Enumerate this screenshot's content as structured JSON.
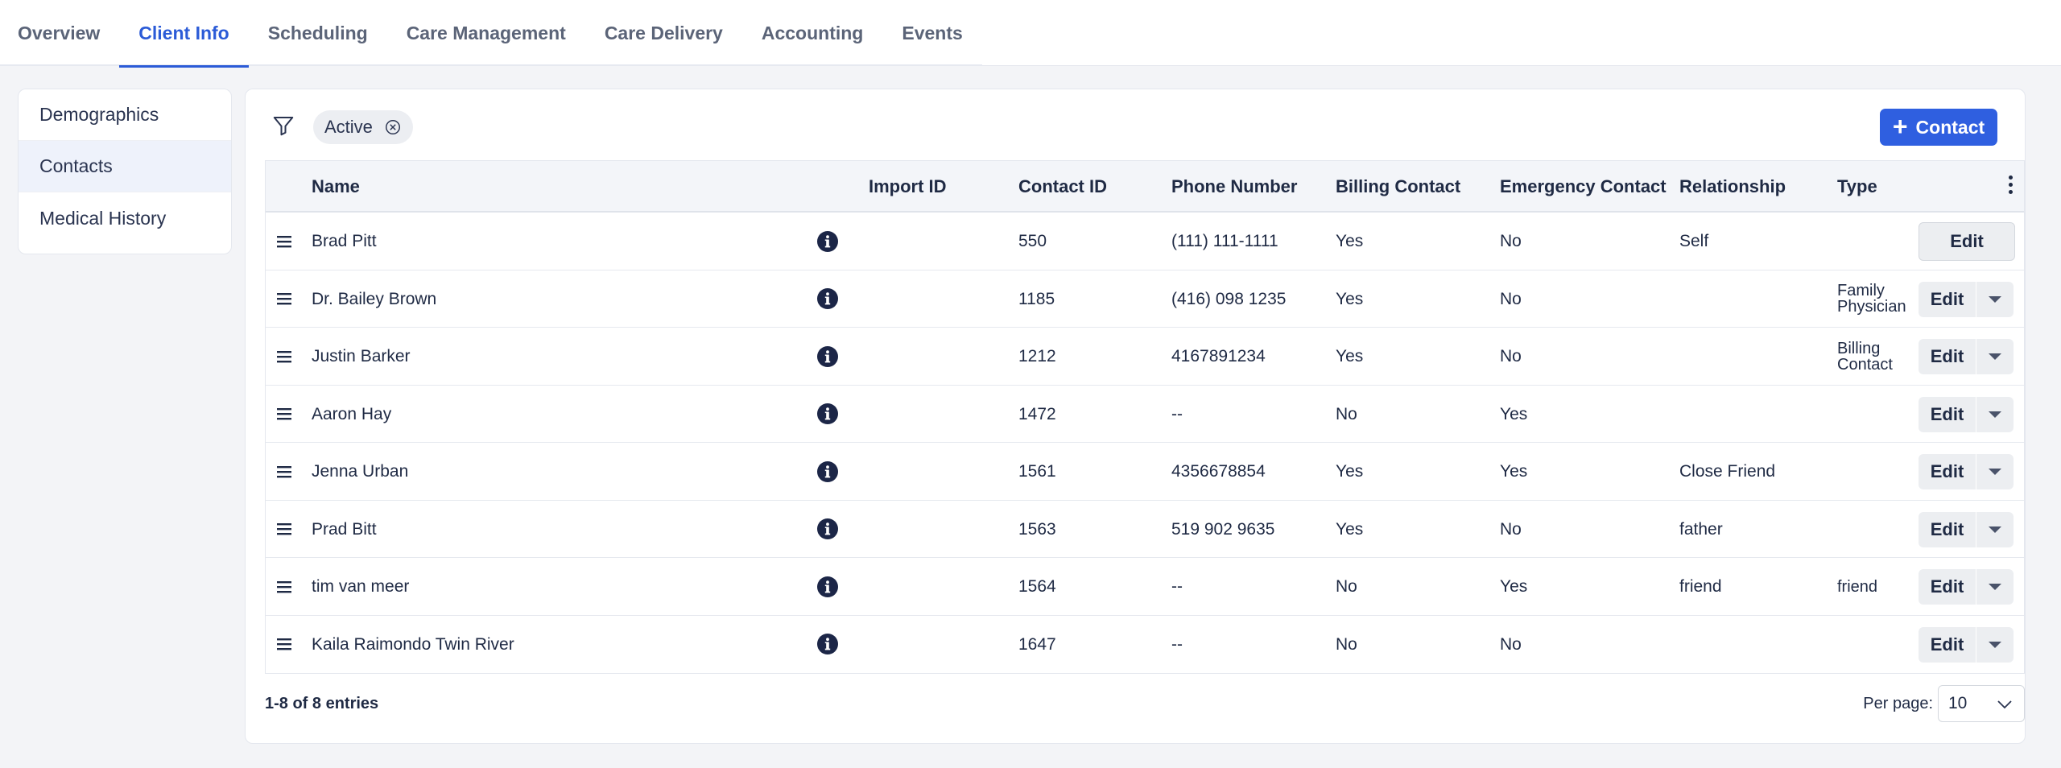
{
  "tabs": [
    {
      "label": "Overview"
    },
    {
      "label": "Client Info"
    },
    {
      "label": "Scheduling"
    },
    {
      "label": "Care Management"
    },
    {
      "label": "Care Delivery"
    },
    {
      "label": "Accounting"
    },
    {
      "label": "Events"
    }
  ],
  "active_tab": "Client Info",
  "sidebar": {
    "items": [
      {
        "label": "Demographics"
      },
      {
        "label": "Contacts"
      },
      {
        "label": "Medical History"
      }
    ],
    "active": "Contacts"
  },
  "filter": {
    "chip_label": "Active"
  },
  "toolbar": {
    "add_label": "Contact"
  },
  "table": {
    "columns": [
      "Name",
      "Import ID",
      "Contact ID",
      "Phone Number",
      "Billing Contact",
      "Emergency Contact",
      "Relationship",
      "Type"
    ],
    "edit_label": "Edit",
    "rows": [
      {
        "name": "Brad Pitt",
        "import_id": "",
        "contact_id": "550",
        "phone": "(111) 111-1111",
        "billing": "Yes",
        "emergency": "No",
        "relationship": "Self",
        "type_line1": "",
        "type_line2": ""
      },
      {
        "name": "Dr. Bailey Brown",
        "import_id": "",
        "contact_id": "1185",
        "phone": "(416) 098 1235",
        "billing": "Yes",
        "emergency": "No",
        "relationship": "",
        "type_line1": "Family",
        "type_line2": "Physician"
      },
      {
        "name": "Justin Barker",
        "import_id": "",
        "contact_id": "1212",
        "phone": "4167891234",
        "billing": "Yes",
        "emergency": "No",
        "relationship": "",
        "type_line1": "Billing",
        "type_line2": "Contact"
      },
      {
        "name": "Aaron Hay",
        "import_id": "",
        "contact_id": "1472",
        "phone": "--",
        "billing": "No",
        "emergency": "Yes",
        "relationship": "",
        "type_line1": "",
        "type_line2": ""
      },
      {
        "name": "Jenna Urban",
        "import_id": "",
        "contact_id": "1561",
        "phone": "4356678854",
        "billing": "Yes",
        "emergency": "Yes",
        "relationship": "Close Friend",
        "type_line1": "",
        "type_line2": ""
      },
      {
        "name": "Prad Bitt",
        "import_id": "",
        "contact_id": "1563",
        "phone": "519 902 9635",
        "billing": "Yes",
        "emergency": "No",
        "relationship": "father",
        "type_line1": "",
        "type_line2": ""
      },
      {
        "name": "tim van meer",
        "import_id": "",
        "contact_id": "1564",
        "phone": "--",
        "billing": "No",
        "emergency": "Yes",
        "relationship": "friend",
        "type_line1": "friend",
        "type_line2": ""
      },
      {
        "name": "Kaila Raimondo Twin River",
        "import_id": "",
        "contact_id": "1647",
        "phone": "--",
        "billing": "No",
        "emergency": "No",
        "relationship": "",
        "type_line1": "",
        "type_line2": ""
      }
    ]
  },
  "footer": {
    "count_text": "1-8 of 8 entries",
    "per_page_label": "Per page:",
    "per_page_value": "10"
  },
  "colors": {
    "accent": "#2b5bd7",
    "primary_button": "#2f5fe0",
    "text": "#1f2a44",
    "muted": "#5b6478"
  }
}
